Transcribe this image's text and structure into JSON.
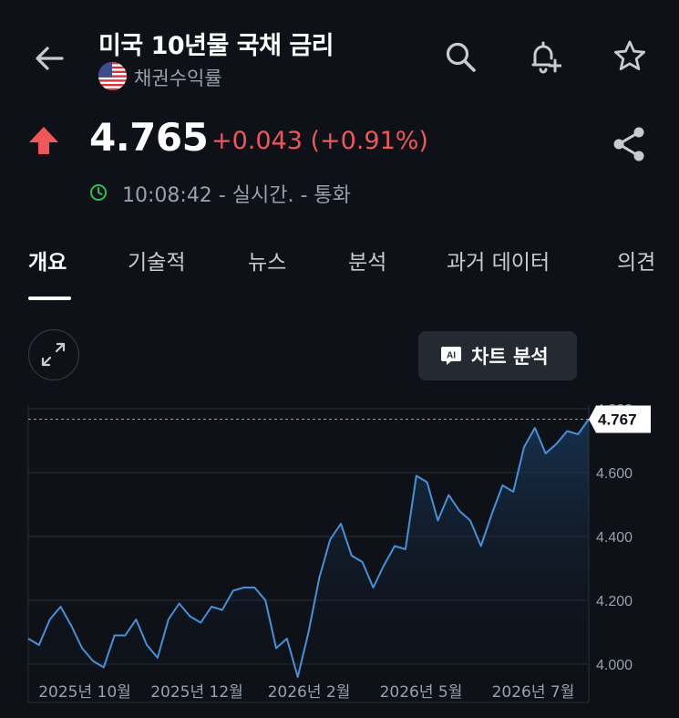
{
  "header": {
    "title": "미국 10년물 국채 금리",
    "subtitle": "채권수익률",
    "icons": {
      "back": "back-arrow-icon",
      "search": "search-icon",
      "alert": "add-alert-icon",
      "watchlist": "star-icon",
      "flag": "us-flag-icon"
    }
  },
  "quote": {
    "price": "4.765",
    "change": "+0.043 (+0.91%)",
    "time": "10:08:42 - 실시간. - 통화",
    "direction": "up",
    "colors": {
      "positive": "#f0575b",
      "live": "#2fbf4f"
    }
  },
  "tabs": [
    {
      "label": "개요",
      "active": true
    },
    {
      "label": "기술적",
      "active": false
    },
    {
      "label": "뉴스",
      "active": false
    },
    {
      "label": "분석",
      "active": false
    },
    {
      "label": "과거 데이터",
      "active": false
    },
    {
      "label": "의견",
      "active": false
    }
  ],
  "chart_controls": {
    "ai_badge": "AI",
    "ai_label": "차트 분석"
  },
  "chart_data": {
    "type": "area",
    "last_value_label": "4.767",
    "y_ticks": [
      "4.000",
      "4.200",
      "4.400",
      "4.600",
      "4.800"
    ],
    "ylim": [
      3.95,
      4.85
    ],
    "x_tick_labels": [
      "2025년 10월",
      "2025년 12월",
      "2026년 2월",
      "2026년 5월",
      "2026년 7월"
    ],
    "series": [
      {
        "color": "#4a90d9",
        "values": [
          4.08,
          4.06,
          4.14,
          4.18,
          4.12,
          4.05,
          4.01,
          3.99,
          4.09,
          4.09,
          4.14,
          4.06,
          4.02,
          4.14,
          4.19,
          4.15,
          4.13,
          4.18,
          4.17,
          4.23,
          4.24,
          4.24,
          4.2,
          4.05,
          4.08,
          3.96,
          4.1,
          4.27,
          4.39,
          4.44,
          4.34,
          4.32,
          4.24,
          4.31,
          4.37,
          4.36,
          4.59,
          4.57,
          4.45,
          4.53,
          4.48,
          4.45,
          4.37,
          4.47,
          4.56,
          4.54,
          4.68,
          4.74,
          4.66,
          4.69,
          4.73,
          4.72,
          4.767
        ]
      }
    ]
  }
}
